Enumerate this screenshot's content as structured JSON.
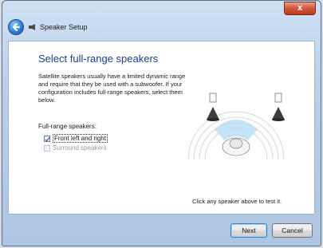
{
  "window": {
    "title": "Speaker Setup",
    "close_glyph": "x"
  },
  "main": {
    "heading": "Select full-range speakers",
    "description": "Satellite speakers usually have a limited dynamic range and require that they be used with a subwoofer. If your configuration includes full-range speakers, select them below.",
    "fullrange_label": "Full-range speakers:",
    "checkboxes": [
      {
        "label": "Front left and right",
        "checked": true,
        "enabled": true
      },
      {
        "label": "Surround speakers",
        "checked": false,
        "enabled": false
      }
    ],
    "hint": "Click any speaker above to test it."
  },
  "buttons": {
    "next": "Next",
    "cancel": "Cancel"
  },
  "icons": {
    "back": "back-arrow-icon",
    "title": "speaker-icon"
  },
  "colors": {
    "heading": "#1e3f8a",
    "accent": "#2f7fd4"
  }
}
